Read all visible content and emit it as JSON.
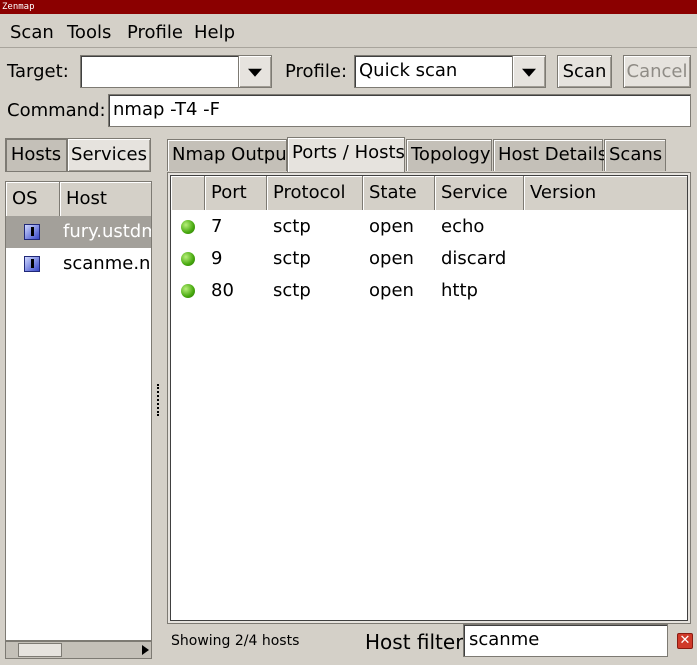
{
  "window": {
    "title": "Zenmap"
  },
  "menu": [
    {
      "label": "Scan"
    },
    {
      "label": "Tools"
    },
    {
      "label": "Profile"
    },
    {
      "label": "Help"
    }
  ],
  "toolbar": {
    "target_label": "Target:",
    "target_value": "",
    "profile_label": "Profile:",
    "profile_value": "Quick scan",
    "scan_button": "Scan",
    "cancel_button": "Cancel",
    "command_label": "Command:",
    "command_value": "nmap -T4 -F"
  },
  "left_panel": {
    "toggle_hosts": "Hosts",
    "toggle_services": "Services",
    "columns": [
      "OS",
      "Host"
    ],
    "hosts": [
      {
        "name": "fury.ustdm",
        "selected": true,
        "os_icon": "linux-host-icon"
      },
      {
        "name": "scanme.nn",
        "selected": false,
        "os_icon": "linux-host-icon"
      }
    ]
  },
  "tabs": [
    {
      "label": "Nmap Output",
      "active": false
    },
    {
      "label": "Ports / Hosts",
      "active": true
    },
    {
      "label": "Topology",
      "active": false
    },
    {
      "label": "Host Details",
      "active": false
    },
    {
      "label": "Scans",
      "active": false
    }
  ],
  "ports_table": {
    "columns": [
      "Port",
      "Protocol",
      "State",
      "Service",
      "Version"
    ],
    "rows": [
      {
        "port": "7",
        "protocol": "sctp",
        "state": "open",
        "service": "echo",
        "version": "",
        "status_color": "#46a80e"
      },
      {
        "port": "9",
        "protocol": "sctp",
        "state": "open",
        "service": "discard",
        "version": "",
        "status_color": "#46a80e"
      },
      {
        "port": "80",
        "protocol": "sctp",
        "state": "open",
        "service": "http",
        "version": "",
        "status_color": "#46a80e"
      }
    ]
  },
  "status": {
    "showing": "Showing 2/4 hosts",
    "filter_label": "Host filter:",
    "filter_value": "scanme"
  },
  "colors": {
    "titlebar": "#8b0000",
    "selection": "#a3a09a",
    "clear_icon": "#d03a2a"
  }
}
